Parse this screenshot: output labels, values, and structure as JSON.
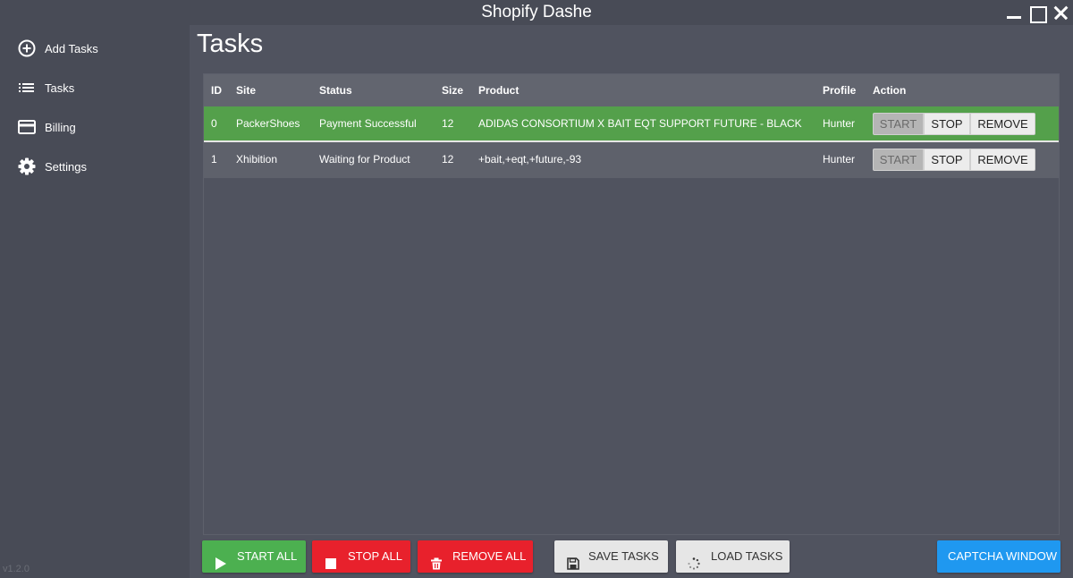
{
  "window": {
    "title": "Shopify Dashe",
    "minimize_icon": "minimize-icon",
    "maximize_icon": "maximize-icon",
    "close_icon": "close-icon"
  },
  "sidebar": {
    "items": [
      {
        "label": "Add Tasks",
        "icon": "plus-circle-icon"
      },
      {
        "label": "Tasks",
        "icon": "list-icon"
      },
      {
        "label": "Billing",
        "icon": "credit-card-icon"
      },
      {
        "label": "Settings",
        "icon": "gear-icon"
      }
    ],
    "version": "v1.2.0"
  },
  "main": {
    "title": "Tasks",
    "table": {
      "columns": [
        "ID",
        "Site",
        "Status",
        "Size",
        "Product",
        "Profile",
        "Action"
      ],
      "rows": [
        {
          "id": "0",
          "site": "PackerShoes",
          "status": "Payment Successful",
          "size": "12",
          "product": "ADIDAS CONSORTIUM X BAIT EQT SUPPORT FUTURE - BLACK",
          "profile": "Hunter",
          "state": "success"
        },
        {
          "id": "1",
          "site": "Xhibition",
          "status": "Waiting for Product",
          "size": "12",
          "product": "+bait,+eqt,+future,-93",
          "profile": "Hunter",
          "state": "waiting"
        }
      ],
      "actions": {
        "start": "START",
        "stop": "STOP",
        "remove": "REMOVE"
      }
    },
    "buttons": {
      "start_all": "START ALL",
      "stop_all": "STOP ALL",
      "remove_all": "REMOVE ALL",
      "save_tasks": "SAVE TASKS",
      "load_tasks": "LOAD TASKS",
      "captcha_window": "CAPTCHA WINDOW"
    }
  },
  "colors": {
    "success_row": "#54a04b",
    "start_all": "#4cb050",
    "stop_all": "#e8212c",
    "remove_all": "#e8212c",
    "captcha": "#1f98f0"
  }
}
